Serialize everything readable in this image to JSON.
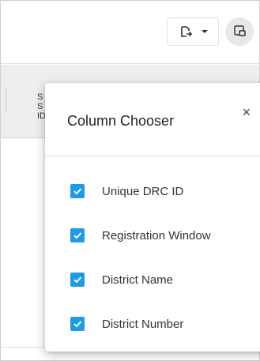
{
  "toolbar": {
    "export_icon": "export-icon",
    "export_dropdown_icon": "caret-down-icon",
    "column_chooser_icon": "column-chooser-icon"
  },
  "grid": {
    "partial_header_text": "S\nS\nID"
  },
  "column_chooser": {
    "title": "Column Chooser",
    "close_label": "×",
    "options": [
      {
        "label": "Unique DRC ID",
        "checked": true
      },
      {
        "label": "Registration Window",
        "checked": true
      },
      {
        "label": "District Name",
        "checked": true
      },
      {
        "label": "District Number",
        "checked": true
      }
    ]
  },
  "colors": {
    "checkbox": "#1e9be8",
    "header_bg": "#eeeeee",
    "chooser_btn_bg": "#e8e8e8"
  }
}
